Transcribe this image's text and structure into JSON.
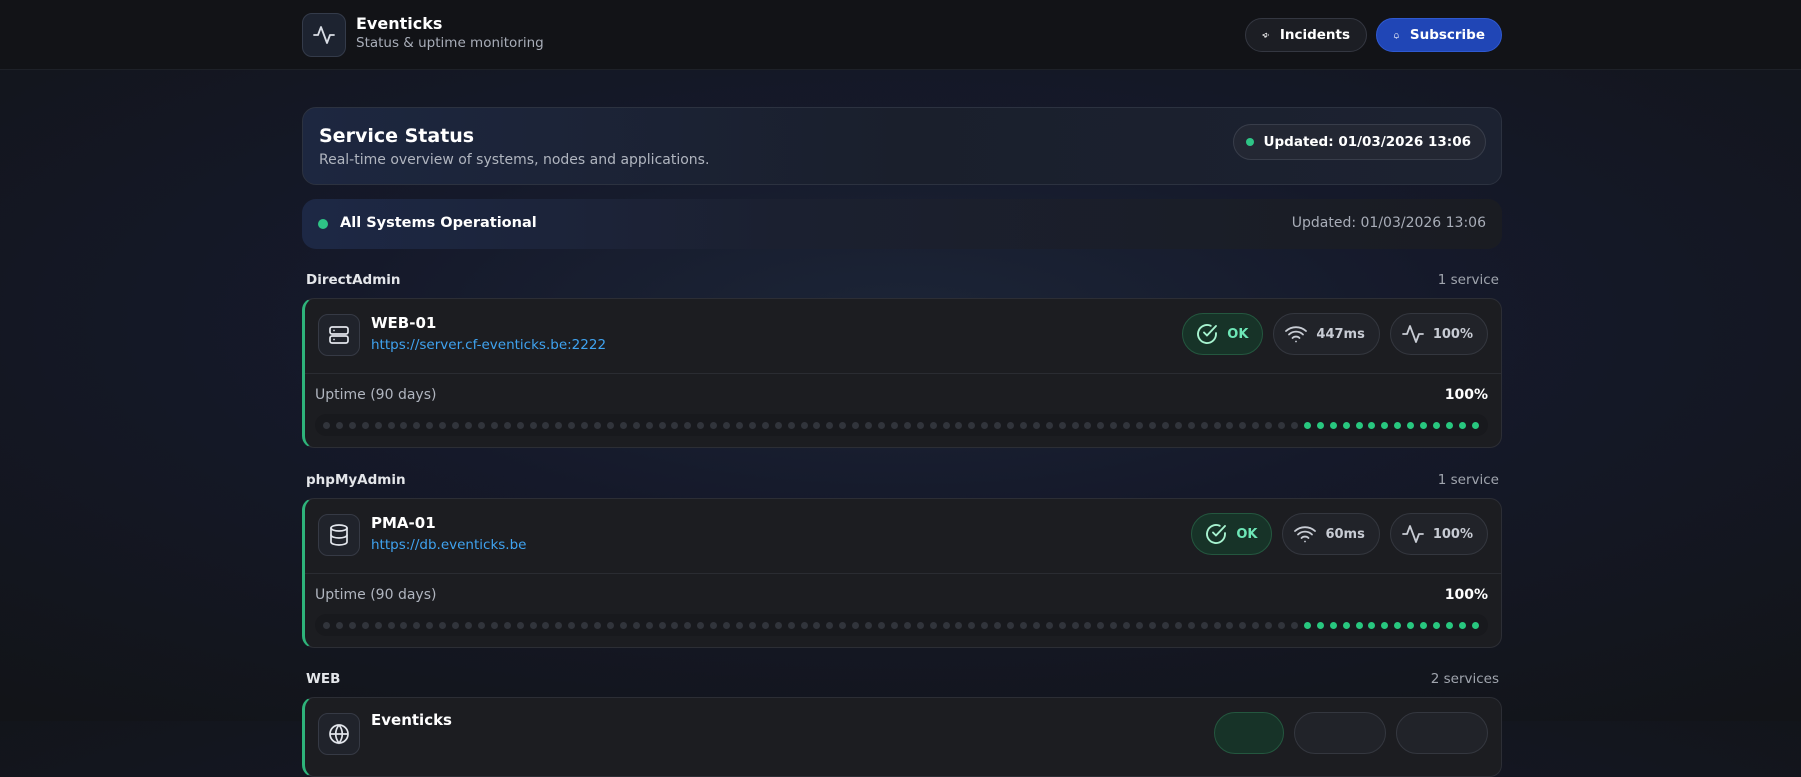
{
  "header": {
    "brand_name": "Eventicks",
    "brand_sub": "Status & uptime monitoring",
    "incidents_label": "Incidents",
    "subscribe_label": "Subscribe"
  },
  "status_panel": {
    "title": "Service Status",
    "subtitle": "Real-time overview of systems, nodes and applications.",
    "updated": "Updated: 01/03/2026 13:06"
  },
  "overall": {
    "text": "All Systems Operational",
    "updated": "Updated: 01/03/2026 13:06"
  },
  "groups": [
    {
      "name": "DirectAdmin",
      "count": "1 service",
      "services": [
        {
          "name": "WEB-01",
          "url": "https://server.cf-eventicks.be:2222",
          "status": "OK",
          "latency": "447ms",
          "uptime": "100%",
          "uptime_label": "Uptime (90 days)",
          "uptime_pct": "100%",
          "icon": "server-icon"
        }
      ]
    },
    {
      "name": "phpMyAdmin",
      "count": "1 service",
      "services": [
        {
          "name": "PMA-01",
          "url": "https://db.eventicks.be",
          "status": "OK",
          "latency": "60ms",
          "uptime": "100%",
          "uptime_label": "Uptime (90 days)",
          "uptime_pct": "100%",
          "icon": "database-icon"
        }
      ]
    },
    {
      "name": "WEB",
      "count": "2 services",
      "services": [
        {
          "name": "Eventicks"
        }
      ]
    }
  ],
  "uptime_bar": {
    "days_total": 90,
    "days_up": 14
  },
  "colors": {
    "ok": "#2ec486",
    "accent": "#2046b6",
    "link": "#3fa3f0"
  }
}
